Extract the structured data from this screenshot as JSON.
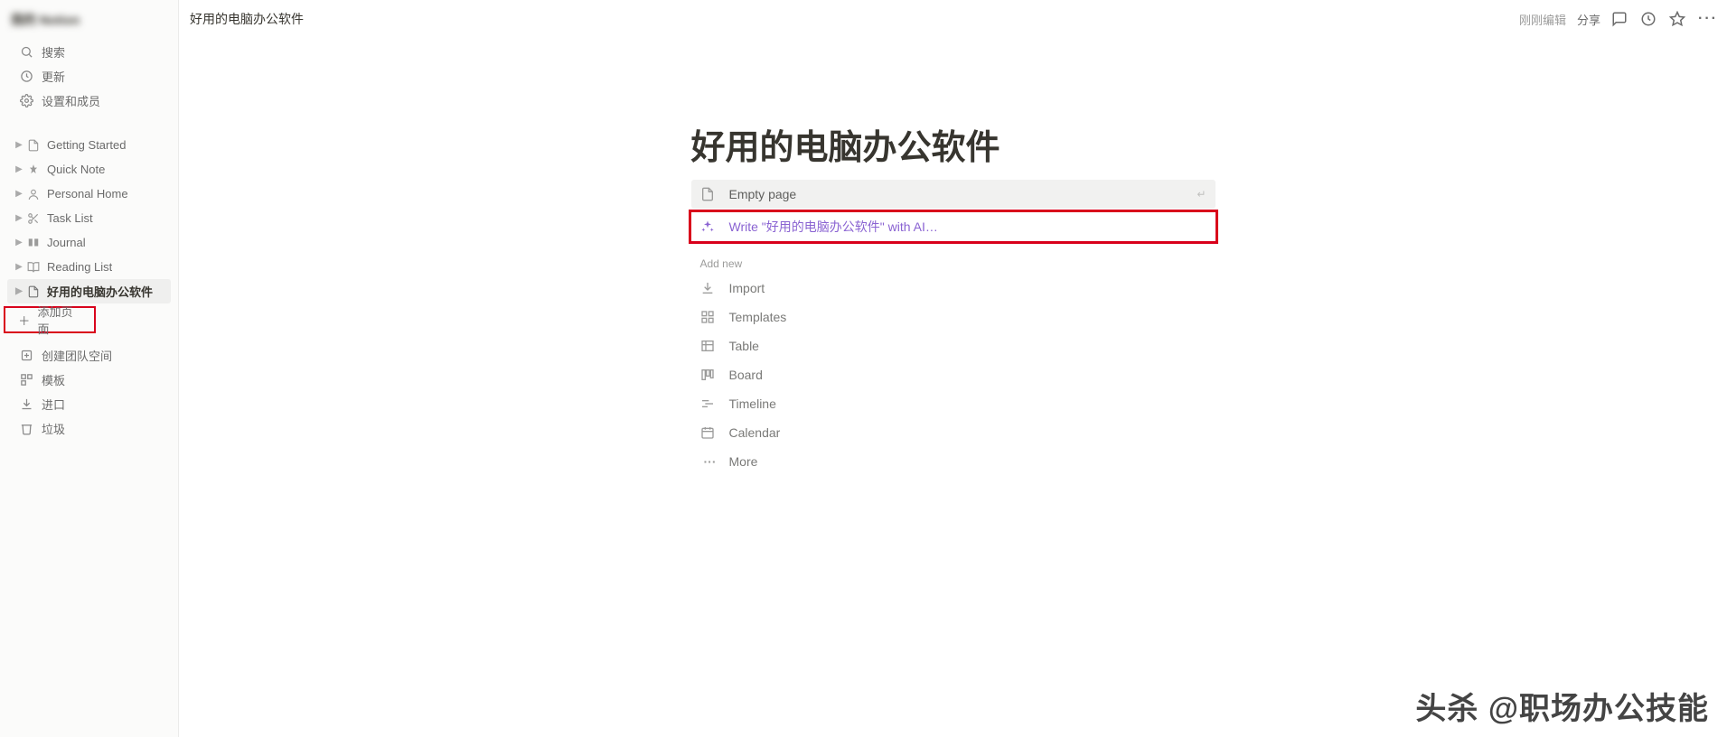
{
  "workspace": {
    "name": "我的 Notion"
  },
  "sidebarTop": [
    {
      "icon": "search-icon",
      "label": "搜索"
    },
    {
      "icon": "clock-icon",
      "label": "更新"
    },
    {
      "icon": "gear-icon",
      "label": "设置和成员"
    }
  ],
  "pages": [
    {
      "icon": "📄",
      "label": "Getting Started"
    },
    {
      "icon": "📌",
      "label": "Quick Note"
    },
    {
      "icon": "👤",
      "label": "Personal Home"
    },
    {
      "icon": "✂️",
      "label": "Task List"
    },
    {
      "icon": "📚",
      "label": "Journal"
    },
    {
      "icon": "📖",
      "label": "Reading List"
    },
    {
      "icon": "📄",
      "label": "好用的电脑办公软件",
      "active": true
    }
  ],
  "addPage": "添加页面",
  "sidebarBottom": [
    {
      "icon": "team-icon",
      "label": "创建团队空间"
    },
    {
      "icon": "template-icon",
      "label": "模板"
    },
    {
      "icon": "import-icon",
      "label": "进口"
    },
    {
      "icon": "trash-icon",
      "label": "垃圾"
    }
  ],
  "breadcrumb": "好用的电脑办公软件",
  "topbarRight": {
    "edit": "刚刚编辑",
    "share": "分享"
  },
  "title": "好用的电脑办公软件",
  "emptyPage": "Empty page",
  "aiWrite": "Write \"好用的电脑办公软件\" with AI…",
  "addNew": "Add new",
  "addOptions": [
    {
      "icon": "download-icon",
      "label": "Import"
    },
    {
      "icon": "templates-icon",
      "label": "Templates"
    },
    {
      "icon": "table-icon",
      "label": "Table"
    },
    {
      "icon": "board-icon",
      "label": "Board"
    },
    {
      "icon": "timeline-icon",
      "label": "Timeline"
    },
    {
      "icon": "calendar-icon",
      "label": "Calendar"
    },
    {
      "icon": "more-icon",
      "label": "More"
    }
  ],
  "watermark": "头杀 @职场办公技能"
}
